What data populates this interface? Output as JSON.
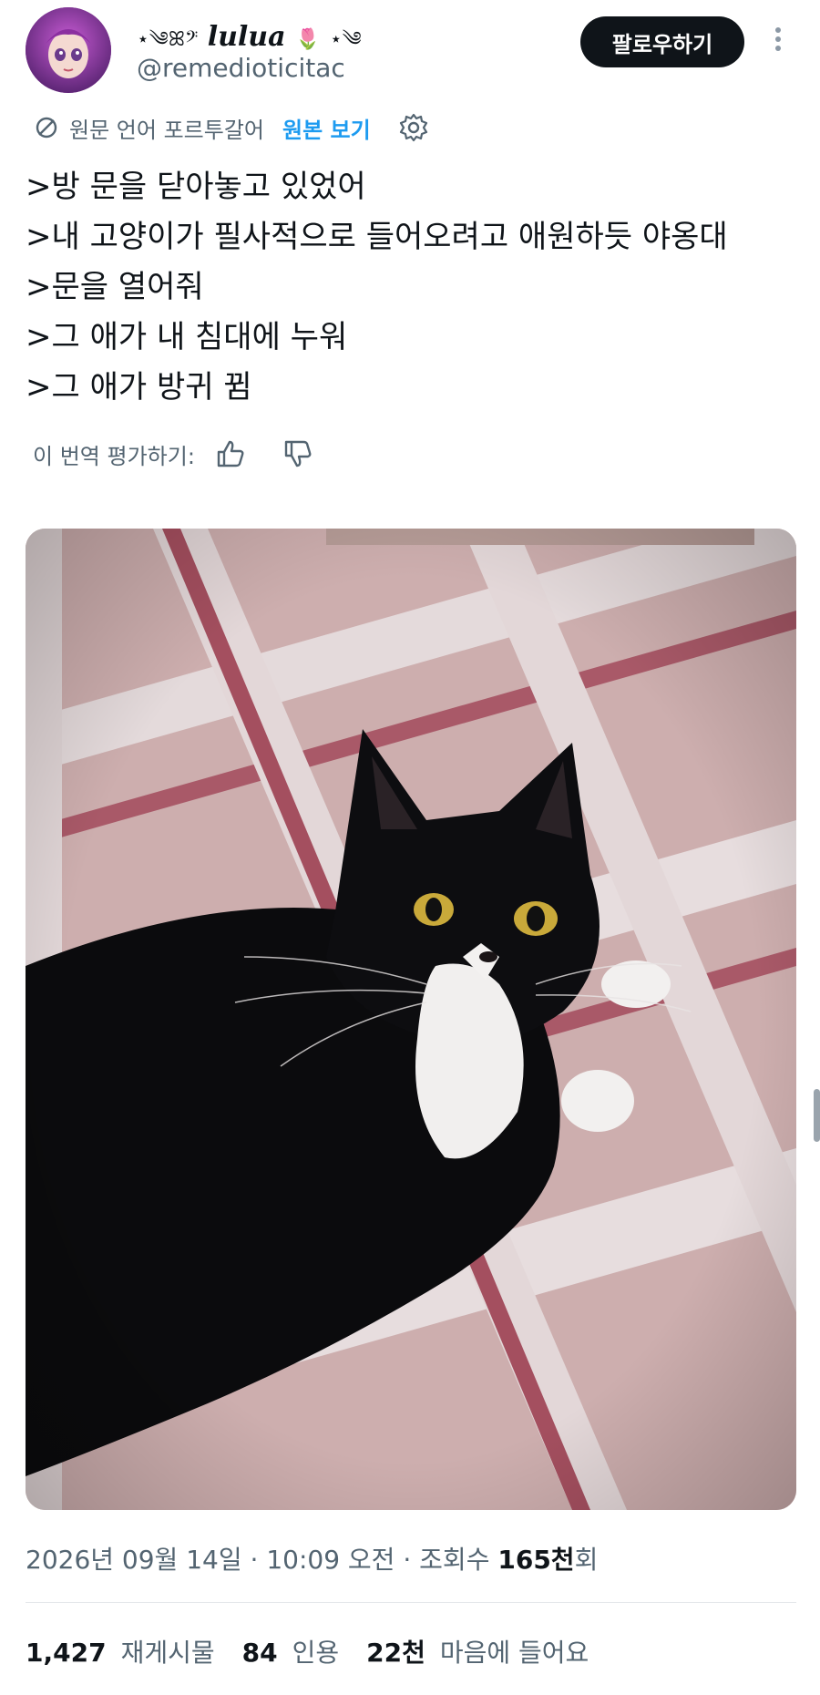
{
  "author": {
    "display_name": "lulua",
    "name_prefix_deco": "⋆༄ꕤ𝄢",
    "name_suffix_deco": "⋆༄",
    "handle": "@remedioticitac"
  },
  "actions": {
    "follow_label": "팔로우하기"
  },
  "translation": {
    "source_text": "원문 언어 포르투갈어",
    "show_original_label": "원본 보기",
    "rate_label": "이 번역 평가하기:"
  },
  "tweet": {
    "lines": [
      ">방 문을 닫아놓고 있었어",
      ">내 고양이가 필사적으로 들어오려고 애원하듯 야옹대",
      ">문을 열어줘",
      ">그 애가 내 침대에 누워",
      ">그 애가 방귀 뀜"
    ]
  },
  "meta": {
    "date": "2026년 09월 14일",
    "time": "10:09 오전",
    "views_label": "조회수",
    "views_value": "165천",
    "views_suffix": "회",
    "separator": "·"
  },
  "stats": {
    "reposts_value": "1,427",
    "reposts_label": "재게시물",
    "quotes_value": "84",
    "quotes_label": "인용",
    "likes_value": "22천",
    "likes_label": "마음에 들어요"
  },
  "colors": {
    "accent": "#1d9bf0",
    "text": "#0f1419",
    "secondary": "#536471",
    "button_dark": "#0f1419"
  },
  "icons": {
    "translate": "translate-icon",
    "settings": "gear-icon",
    "thumbs_up": "thumbs-up-icon",
    "thumbs_down": "thumbs-down-icon",
    "more": "more-icon"
  }
}
